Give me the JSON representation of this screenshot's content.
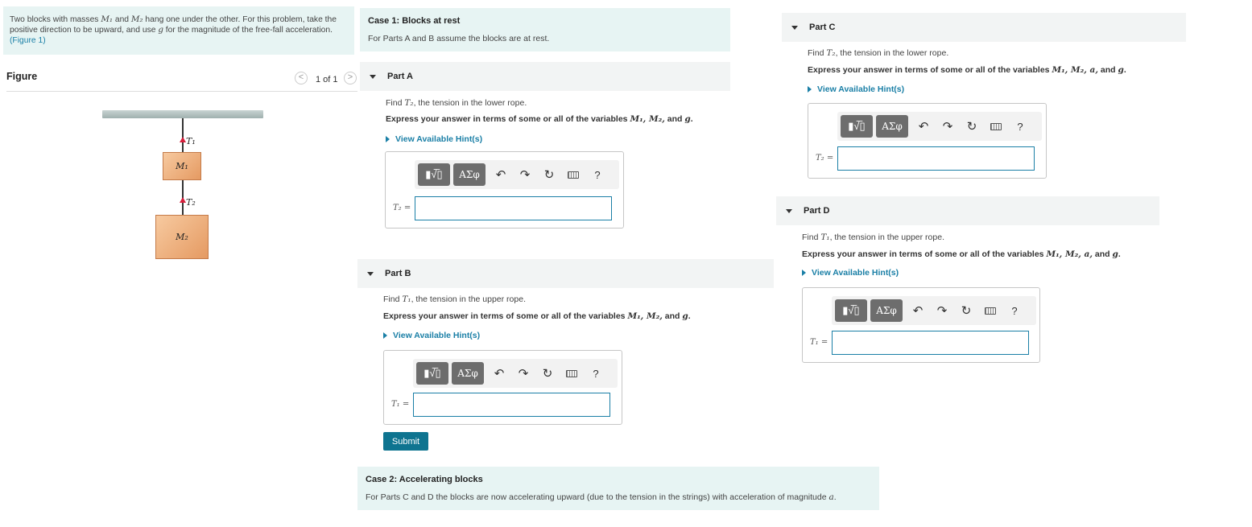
{
  "problem": {
    "line1_a": "Two blocks with masses ",
    "m1": "M₁",
    "line1_and": " and ",
    "m2": "M₂",
    "line1_b": " hang one under the other. For this problem, take the",
    "line2_a": "positive direction to be upward, and use ",
    "g": "g",
    "line2_b": " for the magnitude of the free-fall acceleration.",
    "figure_link": "(Figure 1)"
  },
  "figure": {
    "title": "Figure",
    "prev": "<",
    "next": ">",
    "counter": "1 of 1",
    "t1": "T₁",
    "t2": "T₂",
    "m1": "M₁",
    "m2": "M₂"
  },
  "case1": {
    "title": "Case 1: Blocks at rest",
    "desc": "For Parts A and B assume the blocks are at rest."
  },
  "case2": {
    "title": "Case 2: Accelerating blocks",
    "desc": "For Parts C and D the blocks are now accelerating upward (due to the tension in the strings) with acceleration of magnitude ",
    "a": "a",
    "period": "."
  },
  "toolbar": {
    "sqrt_label": "▮√̅▯",
    "greek_label": "ΑΣφ",
    "undo": "↶",
    "redo": "↷",
    "reset": "↻",
    "help": "?"
  },
  "partA": {
    "label": "Part A",
    "find_pre": "Find ",
    "var": "T₂",
    "find_post": ", the tension in the lower rope.",
    "express": "Express your answer in terms of some or all of the variables ",
    "vars": "M₁, M₂,",
    "and_g": " and ",
    "g": "g",
    "dot": ".",
    "hint": "View Available Hint(s)",
    "eq_label": "T₂ ="
  },
  "partB": {
    "label": "Part B",
    "find_pre": "Find ",
    "var": "T₁",
    "find_post": ", the tension in the upper rope.",
    "express": "Express your answer in terms of some or all of the variables ",
    "vars": "M₁, M₂,",
    "and_g": " and ",
    "g": "g",
    "dot": ".",
    "hint": "View Available Hint(s)",
    "eq_label": "T₁ =",
    "submit": "Submit"
  },
  "partC": {
    "label": "Part C",
    "find_pre": "Find ",
    "var": "T₂",
    "find_post": ", the tension in the lower rope.",
    "express": "Express your answer in terms of some or all of the variables ",
    "vars": "M₁, M₂, a,",
    "and_g": " and ",
    "g": "g",
    "dot": ".",
    "hint": "View Available Hint(s)",
    "eq_label": "T₂ ="
  },
  "partD": {
    "label": "Part D",
    "find_pre": "Find ",
    "var": "T₁",
    "find_post": ", the tension in the upper rope.",
    "express": "Express your answer in terms of some or all of the variables ",
    "vars": "M₁, M₂, a,",
    "and_g": " and ",
    "g": "g",
    "dot": ".",
    "hint": "View Available Hint(s)",
    "eq_label": "T₁ ="
  }
}
